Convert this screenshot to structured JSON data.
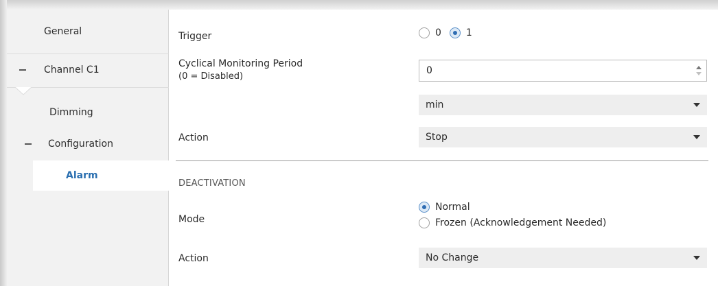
{
  "sidebar": {
    "items": [
      {
        "label": "General"
      },
      {
        "label": "Channel C1"
      },
      {
        "label": "Dimming"
      },
      {
        "label": "Configuration"
      },
      {
        "label": "Alarm",
        "selected": true
      }
    ]
  },
  "alarm": {
    "trigger": {
      "label": "Trigger",
      "options": [
        "0",
        "1"
      ],
      "selected": "1"
    },
    "cyclical": {
      "label_line1": "Cyclical Monitoring Period",
      "label_line2": "(0 = Disabled)",
      "value": "0",
      "unit": "min"
    },
    "action": {
      "label": "Action",
      "value": "Stop"
    }
  },
  "deactivation": {
    "title": "DEACTIVATION",
    "mode": {
      "label": "Mode",
      "options": [
        "Normal",
        "Frozen (Acknowledgement Needed)"
      ],
      "selected": "Normal"
    },
    "action": {
      "label": "Action",
      "value": "No Change"
    }
  },
  "colors": {
    "sidebar_bg": "#f2f2f2",
    "selected_text": "#2a6fb0",
    "radio_checked": "#2f6db3",
    "select_bg": "#eeeeee"
  }
}
